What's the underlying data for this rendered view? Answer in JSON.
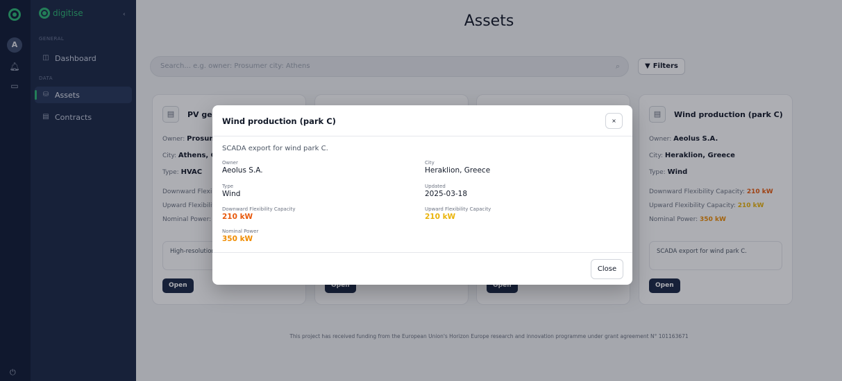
{
  "app": {
    "brand": "digitise",
    "avatar_initial": "A"
  },
  "sidebar": {
    "section_general": "GENERAL",
    "section_data": "DATA",
    "items": [
      {
        "label": "Dashboard",
        "icon": "dashboard-icon"
      },
      {
        "label": "Assets",
        "icon": "database-icon",
        "active": true
      },
      {
        "label": "Contracts",
        "icon": "document-icon"
      }
    ]
  },
  "main": {
    "title": "Assets",
    "search": {
      "placeholder": "Search... e.g. owner: Prosumer city: Athens"
    },
    "filters_label": "Filters",
    "footer": "This project has received funding from the European Union's Horizon Europe research and innovation programme under grant agreement N° 101163671"
  },
  "labels": {
    "owner": "Owner:",
    "city": "City:",
    "type": "Type:",
    "downward": "Downward Flexibility Capacity:",
    "upward": "Upward Flexibility Capacity:",
    "nominal": "Nominal Power:",
    "open": "Open"
  },
  "cards": [
    {
      "title": "PV gen",
      "owner": "Prosume",
      "city": "Athens, Gr",
      "type": "HVAC",
      "downward_label": "Downward Flexibility",
      "upward_label": "Upward Flexibility",
      "nominal_label": "Nominal Power:",
      "nominal": "5",
      "desc": "High-resolution dataset for zon"
    },
    {
      "title": "Wind production (park C)",
      "owner": "Aeolus S.A.",
      "city": "Heraklion, Greece",
      "type": "Wind",
      "downward": "210 kW",
      "upward": "210 kW",
      "nominal": "350 kW",
      "desc": "SCADA export for wind park C."
    }
  ],
  "modal": {
    "title": "Wind production (park C)",
    "close_x": "×",
    "description": "SCADA export for wind park C.",
    "fields": {
      "owner_label": "Owner",
      "owner": "Aeolus S.A.",
      "city_label": "City",
      "city": "Heraklion, Greece",
      "type_label": "Type",
      "type": "Wind",
      "updated_label": "Updated",
      "updated": "2025-03-18",
      "downward_label": "Downward Flexibility Capacity",
      "downward": "210 kW",
      "upward_label": "Upward Flexibility Capacity",
      "upward": "210 kW",
      "nominal_label": "Nominal Power",
      "nominal": "350 kW"
    },
    "close_label": "Close"
  },
  "colors": {
    "accent": "#2bb673",
    "sidebar": "#1a2744",
    "downward": "#e8590c",
    "upward": "#eab308",
    "nominal": "#f08c00"
  }
}
